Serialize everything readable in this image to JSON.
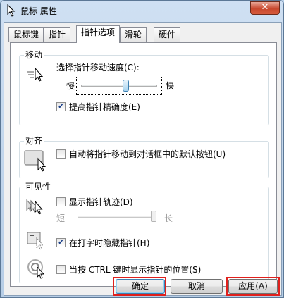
{
  "window": {
    "title": "鼠标 属性",
    "close_symbol": "✕",
    "title_icon": "mouse-pointer-icon"
  },
  "tabs": [
    {
      "label": "鼠标键"
    },
    {
      "label": "指针"
    },
    {
      "label": "指针选项",
      "active": true
    },
    {
      "label": "滑轮"
    },
    {
      "label": "硬件"
    }
  ],
  "motion": {
    "heading": "移动",
    "speed_label": "选择指针移动速度(C):",
    "slow_label": "慢",
    "fast_label": "快",
    "speed_level": 0.6,
    "precision_label": "提高指针精确度(E)",
    "precision_checked": true
  },
  "snap": {
    "heading": "对齐",
    "snap_label": "自动将指针移动到对话框中的默认按钮(U)",
    "snap_checked": false
  },
  "visibility": {
    "heading": "可见性",
    "trails_label": "显示指针轨迹(D)",
    "trails_checked": false,
    "short_label": "短",
    "long_label": "长",
    "trail_level": 1.0,
    "hide_label": "在打字时隐藏指针(H)",
    "hide_checked": true,
    "ctrl_label": "当按 CTRL 键时显示指针的位置(S)",
    "ctrl_checked": false
  },
  "buttons": {
    "ok": "确定",
    "cancel": "取消",
    "apply": "应用(A)"
  },
  "colors": {
    "highlight": "#e0201c",
    "accent": "#3c7fb1"
  }
}
